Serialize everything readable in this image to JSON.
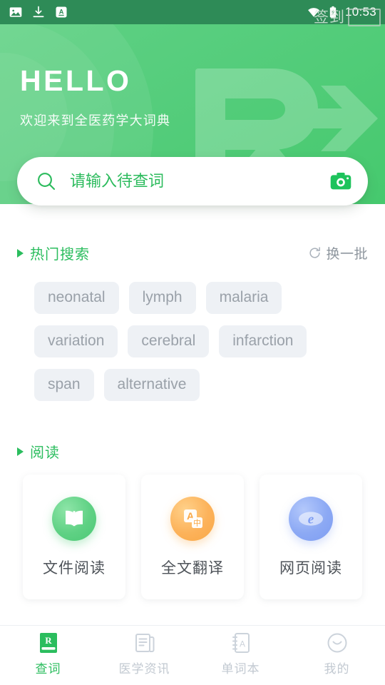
{
  "status_bar": {
    "left_icons": [
      "image-icon",
      "download-icon",
      "app-a-icon"
    ],
    "watermark_text": "签到",
    "wifi_icon": "wifi-icon",
    "battery_icon": "battery-charging-icon",
    "time": "10:53"
  },
  "header": {
    "title": "HELLO",
    "subtitle": "欢迎来到全医药学大词典",
    "watermark_icon": "rx-arrow-watermark",
    "bg_color": "#55cd7c"
  },
  "search": {
    "placeholder": "请输入待查词",
    "value": "",
    "search_icon": "search-icon",
    "camera_icon": "camera-icon",
    "accent_color": "#2cbb5d"
  },
  "hot_search": {
    "title": "热门搜索",
    "bullet_icon": "triangle-right-icon",
    "refresh_label": "换一批",
    "refresh_icon": "refresh-icon",
    "tags": [
      "neonatal",
      "lymph",
      "malaria",
      "variation",
      "cerebral",
      "infarction",
      "span",
      "alternative"
    ]
  },
  "reading": {
    "title": "阅读",
    "bullet_icon": "triangle-right-icon",
    "cards": [
      {
        "label": "文件阅读",
        "icon": "book-open-icon",
        "color": "#5fd184"
      },
      {
        "label": "全文翻译",
        "icon": "translate-icon",
        "color": "#fcb25a"
      },
      {
        "label": "网页阅读",
        "icon": "browser-e-icon",
        "color": "#8ca9f4"
      }
    ]
  },
  "tab_bar": {
    "active_index": 0,
    "items": [
      {
        "label": "查词",
        "icon": "rx-book-icon"
      },
      {
        "label": "医学资讯",
        "icon": "news-icon"
      },
      {
        "label": "单词本",
        "icon": "notebook-a-icon"
      },
      {
        "label": "我的",
        "icon": "smiley-face-icon"
      }
    ]
  }
}
